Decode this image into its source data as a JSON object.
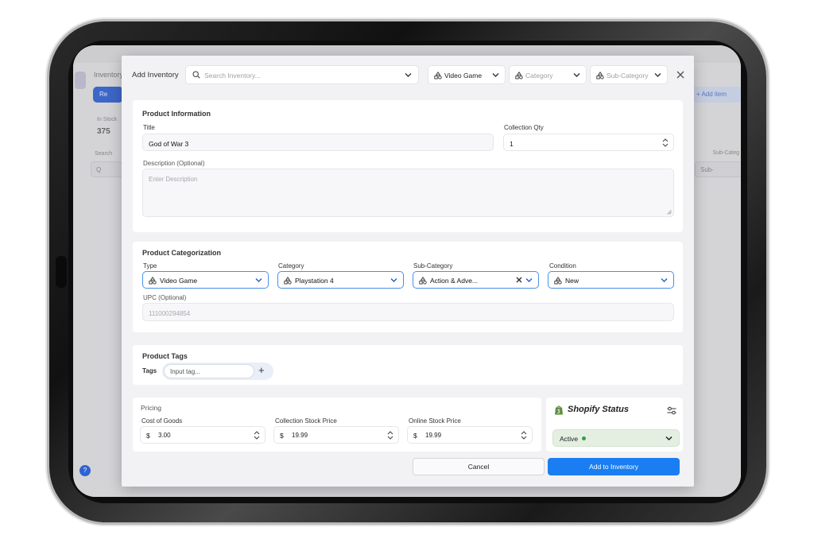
{
  "background_app": {
    "title": "Inventory",
    "primary_button": "Re",
    "right_button": "+ Add item",
    "stat_label": "In Stock",
    "stat_value": "375",
    "search_label": "Search",
    "search_placeholder": "Q",
    "subcategory_label": "Sub-Categ",
    "subcategory_placeholder": "Sub-",
    "help_badge": "?"
  },
  "modal": {
    "title": "Add Inventory",
    "search_placeholder": "Search Inventory...",
    "filters": {
      "type": "Video Game",
      "category_placeholder": "Category",
      "subcategory_placeholder": "Sub-Category"
    }
  },
  "product_information": {
    "heading": "Product Information",
    "title_label": "Title",
    "title_value": "God of War 3",
    "qty_label": "Collection Qty",
    "qty_value": "1",
    "description_label": "Description (Optional)",
    "description_placeholder": "Enter Description"
  },
  "categorization": {
    "heading": "Product Categorization",
    "type_label": "Type",
    "type_value": "Video Game",
    "category_label": "Category",
    "category_value": "Playstation 4",
    "subcategory_label": "Sub-Category",
    "subcategory_value": "Action & Adve...",
    "condition_label": "Condition",
    "condition_value": "New",
    "upc_label": "UPC (Optional)",
    "upc_placeholder": "111000294854"
  },
  "tags": {
    "heading": "Product Tags",
    "label": "Tags",
    "placeholder": "Input tag...",
    "add_symbol": "+"
  },
  "pricing": {
    "heading": "Pricing",
    "currency": "$",
    "cost_label": "Cost of Goods",
    "cost_value": "3.00",
    "collection_label": "Collection Stock Price",
    "collection_value": "19.99",
    "online_label": "Online Stock Price",
    "online_value": "19.99"
  },
  "shopify": {
    "title": "Shopify Status",
    "status": "Active",
    "status_color": "#2aa24a"
  },
  "actions": {
    "cancel": "Cancel",
    "add": "Add to Inventory"
  },
  "colors": {
    "accent": "#1a7ef2",
    "select_border": "#4a8fe8"
  }
}
